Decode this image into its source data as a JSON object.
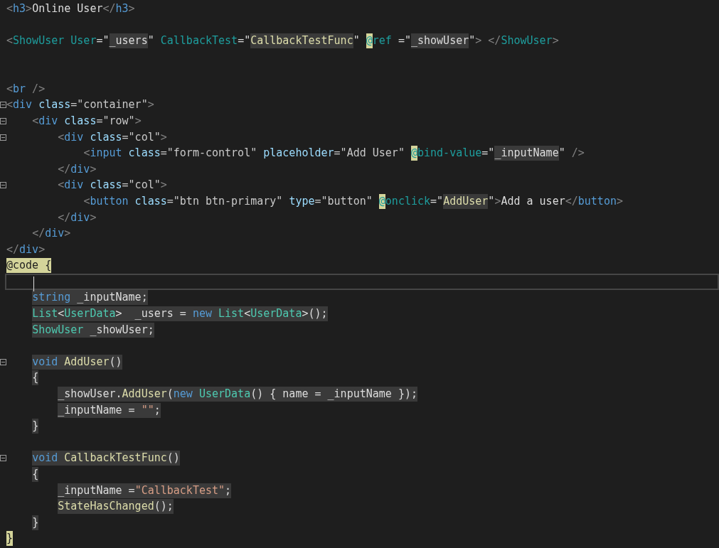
{
  "editor": {
    "lines": [
      {
        "tokens": [
          {
            "text": "<",
            "kind": "p"
          },
          {
            "text": "h3",
            "kind": "e"
          },
          {
            "text": ">",
            "kind": "p"
          },
          {
            "text": "Online User",
            "kind": "x"
          },
          {
            "text": "</",
            "kind": "p"
          },
          {
            "text": "h3",
            "kind": "e"
          },
          {
            "text": ">",
            "kind": "p"
          }
        ]
      },
      {
        "blank": true
      },
      {
        "tokens": [
          {
            "text": "<",
            "kind": "p"
          },
          {
            "text": "ShowUser",
            "kind": "c"
          },
          {
            "text": " User",
            "kind": "c"
          },
          {
            "text": "=\"",
            "kind": "x"
          },
          {
            "text": "_users",
            "kind": "x",
            "shaded": true
          },
          {
            "text": "\" ",
            "kind": "x"
          },
          {
            "text": "CallbackTest",
            "kind": "c"
          },
          {
            "text": "=\"",
            "kind": "x"
          },
          {
            "text": "CallbackTestFunc",
            "kind": "m",
            "shaded": true
          },
          {
            "text": "\" ",
            "kind": "x"
          },
          {
            "text": "@",
            "kind": "r",
            "matched": true
          },
          {
            "text": "ref",
            "kind": "r"
          },
          {
            "text": " =\"",
            "kind": "x"
          },
          {
            "text": "_showUser",
            "kind": "x",
            "shaded": true
          },
          {
            "text": "\"",
            "kind": "x"
          },
          {
            "text": "> </",
            "kind": "p"
          },
          {
            "text": "ShowUser",
            "kind": "c"
          },
          {
            "text": ">",
            "kind": "p"
          }
        ]
      },
      {
        "blank": true
      },
      {
        "blank": true
      },
      {
        "tokens": [
          {
            "text": "<",
            "kind": "p"
          },
          {
            "text": "br",
            "kind": "e"
          },
          {
            "text": " />",
            "kind": "p"
          }
        ]
      },
      {
        "fold": true,
        "tokens": [
          {
            "text": "<",
            "kind": "p"
          },
          {
            "text": "div",
            "kind": "e"
          },
          {
            "text": " class",
            "kind": "a"
          },
          {
            "text": "=\"container\"",
            "kind": "s"
          },
          {
            "text": ">",
            "kind": "p"
          }
        ]
      },
      {
        "fold": true,
        "tokens": [
          {
            "text": "    <",
            "kind": "p"
          },
          {
            "text": "div",
            "kind": "e"
          },
          {
            "text": " class",
            "kind": "a"
          },
          {
            "text": "=\"row\"",
            "kind": "s"
          },
          {
            "text": ">",
            "kind": "p"
          }
        ]
      },
      {
        "fold": true,
        "tokens": [
          {
            "text": "        <",
            "kind": "p"
          },
          {
            "text": "div",
            "kind": "e"
          },
          {
            "text": " class",
            "kind": "a"
          },
          {
            "text": "=\"col\"",
            "kind": "s"
          },
          {
            "text": ">",
            "kind": "p"
          }
        ]
      },
      {
        "tokens": [
          {
            "text": "            <",
            "kind": "p"
          },
          {
            "text": "input",
            "kind": "e"
          },
          {
            "text": " class",
            "kind": "a"
          },
          {
            "text": "=\"form-control\" ",
            "kind": "s"
          },
          {
            "text": "placeholder",
            "kind": "a"
          },
          {
            "text": "=\"Add User\" ",
            "kind": "s"
          },
          {
            "text": "@",
            "kind": "r",
            "matched": true
          },
          {
            "text": "bind-value",
            "kind": "r"
          },
          {
            "text": "=\"",
            "kind": "x"
          },
          {
            "text": "_inputName",
            "kind": "x",
            "shaded": true
          },
          {
            "text": "\" ",
            "kind": "x"
          },
          {
            "text": "/>",
            "kind": "p"
          }
        ]
      },
      {
        "tokens": [
          {
            "text": "        </",
            "kind": "p"
          },
          {
            "text": "div",
            "kind": "e"
          },
          {
            "text": ">",
            "kind": "p"
          }
        ]
      },
      {
        "fold": true,
        "tokens": [
          {
            "text": "        <",
            "kind": "p"
          },
          {
            "text": "div",
            "kind": "e"
          },
          {
            "text": " class",
            "kind": "a"
          },
          {
            "text": "=\"col\"",
            "kind": "s"
          },
          {
            "text": ">",
            "kind": "p"
          }
        ]
      },
      {
        "tokens": [
          {
            "text": "            <",
            "kind": "p"
          },
          {
            "text": "button",
            "kind": "e"
          },
          {
            "text": " class",
            "kind": "a"
          },
          {
            "text": "=\"btn btn-primary\" ",
            "kind": "s"
          },
          {
            "text": "type",
            "kind": "a"
          },
          {
            "text": "=\"button\" ",
            "kind": "s"
          },
          {
            "text": "@",
            "kind": "r",
            "matched": true
          },
          {
            "text": "onclick",
            "kind": "r"
          },
          {
            "text": "=\"",
            "kind": "x"
          },
          {
            "text": "AddUser",
            "kind": "m",
            "shaded": true
          },
          {
            "text": "\"",
            "kind": "x"
          },
          {
            "text": ">",
            "kind": "p"
          },
          {
            "text": "Add a user",
            "kind": "x"
          },
          {
            "text": "</",
            "kind": "p"
          },
          {
            "text": "button",
            "kind": "e"
          },
          {
            "text": ">",
            "kind": "p"
          }
        ]
      },
      {
        "tokens": [
          {
            "text": "        </",
            "kind": "p"
          },
          {
            "text": "div",
            "kind": "e"
          },
          {
            "text": ">",
            "kind": "p"
          }
        ]
      },
      {
        "tokens": [
          {
            "text": "    </",
            "kind": "p"
          },
          {
            "text": "div",
            "kind": "e"
          },
          {
            "text": ">",
            "kind": "p"
          }
        ]
      },
      {
        "tokens": [
          {
            "text": "</",
            "kind": "p"
          },
          {
            "text": "div",
            "kind": "e"
          },
          {
            "text": ">",
            "kind": "p"
          }
        ]
      },
      {
        "tokens": [
          {
            "text": "@code",
            "kind": "d",
            "matched": true
          },
          {
            "text": " {",
            "kind": "d",
            "matched": true
          }
        ]
      },
      {
        "current": true
      },
      {
        "tokens": [
          {
            "text": "    string ",
            "kind": "k",
            "shaded": true
          },
          {
            "text": "_inputName;",
            "kind": "n",
            "shaded": true
          }
        ]
      },
      {
        "tokens": [
          {
            "text": "    List",
            "kind": "t",
            "shaded": true
          },
          {
            "text": "<",
            "kind": "n",
            "shaded": true
          },
          {
            "text": "UserData",
            "kind": "t",
            "shaded": true
          },
          {
            "text": ">  _users = ",
            "kind": "n",
            "shaded": true
          },
          {
            "text": "new ",
            "kind": "k",
            "shaded": true
          },
          {
            "text": "List",
            "kind": "t",
            "shaded": true
          },
          {
            "text": "<",
            "kind": "n",
            "shaded": true
          },
          {
            "text": "UserData",
            "kind": "t",
            "shaded": true
          },
          {
            "text": ">();",
            "kind": "n",
            "shaded": true
          }
        ]
      },
      {
        "tokens": [
          {
            "text": "    ShowUser ",
            "kind": "t",
            "shaded": true
          },
          {
            "text": "_showUser;",
            "kind": "n",
            "shaded": true
          }
        ]
      },
      {
        "blank": true
      },
      {
        "fold": true,
        "tokens": [
          {
            "text": "    void ",
            "kind": "k",
            "shaded": true
          },
          {
            "text": "AddUser",
            "kind": "m",
            "shaded": true
          },
          {
            "text": "()",
            "kind": "n",
            "shaded": true
          }
        ]
      },
      {
        "tokens": [
          {
            "text": "    {",
            "kind": "n",
            "shaded": true
          }
        ]
      },
      {
        "tokens": [
          {
            "text": "        _showUser.",
            "kind": "n",
            "shaded": true
          },
          {
            "text": "AddUser",
            "kind": "m",
            "shaded": true
          },
          {
            "text": "(",
            "kind": "n",
            "shaded": true
          },
          {
            "text": "new ",
            "kind": "k",
            "shaded": true
          },
          {
            "text": "UserData",
            "kind": "t",
            "shaded": true
          },
          {
            "text": "() { name = _inputName });",
            "kind": "n",
            "shaded": true
          }
        ]
      },
      {
        "tokens": [
          {
            "text": "        _inputName = ",
            "kind": "n",
            "shaded": true
          },
          {
            "text": "\"\"",
            "kind": "q",
            "shaded": true
          },
          {
            "text": ";",
            "kind": "n",
            "shaded": true
          }
        ]
      },
      {
        "tokens": [
          {
            "text": "    }",
            "kind": "n",
            "shaded": true
          }
        ]
      },
      {
        "blank": true
      },
      {
        "fold": true,
        "tokens": [
          {
            "text": "    void ",
            "kind": "k",
            "shaded": true
          },
          {
            "text": "CallbackTestFunc",
            "kind": "m",
            "shaded": true
          },
          {
            "text": "()",
            "kind": "n",
            "shaded": true
          }
        ]
      },
      {
        "tokens": [
          {
            "text": "    {",
            "kind": "n",
            "shaded": true
          }
        ]
      },
      {
        "tokens": [
          {
            "text": "        _inputName =",
            "kind": "n",
            "shaded": true
          },
          {
            "text": "\"CallbackTest\"",
            "kind": "q",
            "shaded": true
          },
          {
            "text": ";",
            "kind": "n",
            "shaded": true
          }
        ]
      },
      {
        "tokens": [
          {
            "text": "        StateHasChanged",
            "kind": "m",
            "shaded": true
          },
          {
            "text": "();",
            "kind": "n",
            "shaded": true
          }
        ]
      },
      {
        "tokens": [
          {
            "text": "    }",
            "kind": "n",
            "shaded": true
          }
        ]
      },
      {
        "tokens": [
          {
            "text": "}",
            "kind": "d",
            "matched": true
          }
        ]
      }
    ]
  }
}
